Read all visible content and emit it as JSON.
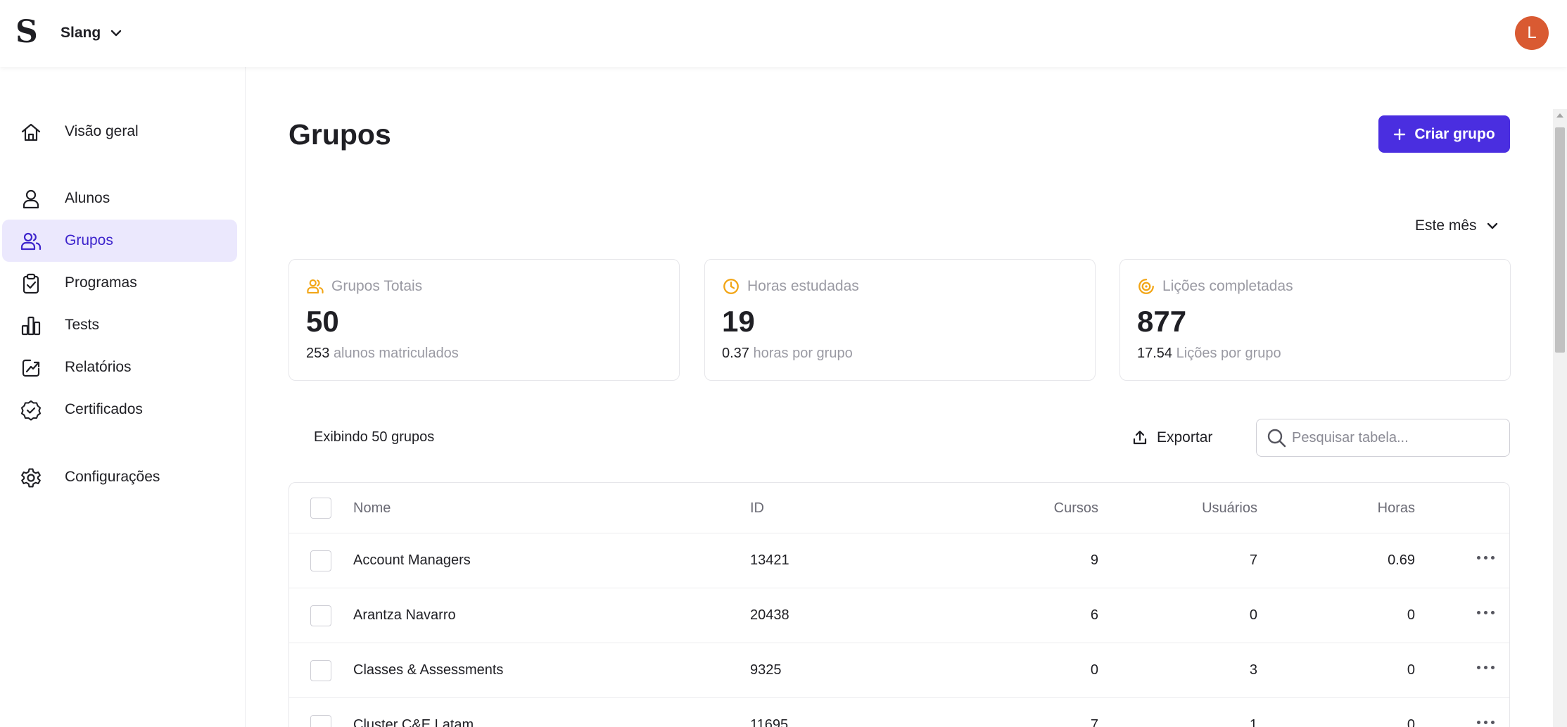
{
  "header": {
    "logo": "S",
    "workspace": "Slang",
    "avatar_initial": "L",
    "avatar_color": "#d95a32"
  },
  "sidebar": {
    "items": [
      {
        "label": "Visão geral",
        "icon": "home-icon",
        "active": false
      },
      {
        "label": "Alunos",
        "icon": "user-icon",
        "active": false
      },
      {
        "label": "Grupos",
        "icon": "users-icon",
        "active": true
      },
      {
        "label": "Programas",
        "icon": "clipboard-check-icon",
        "active": false
      },
      {
        "label": "Tests",
        "icon": "bar-chart-icon",
        "active": false
      },
      {
        "label": "Relatórios",
        "icon": "trending-up-icon",
        "active": false
      },
      {
        "label": "Certificados",
        "icon": "badge-icon",
        "active": false
      },
      {
        "label": "Configurações",
        "icon": "gear-icon",
        "active": false
      }
    ]
  },
  "main": {
    "title": "Grupos",
    "create_button": "Criar grupo",
    "period": "Este mês",
    "stats": [
      {
        "label": "Grupos Totais",
        "value": "50",
        "sub_value": "253",
        "sub_label": "alunos matriculados",
        "icon": "users-icon"
      },
      {
        "label": "Horas estudadas",
        "value": "19",
        "sub_value": "0.37",
        "sub_label": "horas por grupo",
        "icon": "clock-icon"
      },
      {
        "label": "Lições completadas",
        "value": "877",
        "sub_value": "17.54",
        "sub_label": "Lições por grupo",
        "icon": "target-icon"
      }
    ],
    "showing": "Exibindo 50 grupos",
    "export": "Exportar",
    "search_placeholder": "Pesquisar tabela...",
    "accent": "#4a2ee0",
    "stat_icon_color": "#f2a515"
  },
  "table": {
    "columns": {
      "name": "Nome",
      "id": "ID",
      "courses": "Cursos",
      "users": "Usuários",
      "hours": "Horas"
    },
    "rows": [
      {
        "name": "Account Managers",
        "id": "13421",
        "courses": "9",
        "users": "7",
        "hours": "0.69"
      },
      {
        "name": "Arantza Navarro",
        "id": "20438",
        "courses": "6",
        "users": "0",
        "hours": "0"
      },
      {
        "name": "Classes & Assessments",
        "id": "9325",
        "courses": "0",
        "users": "3",
        "hours": "0"
      },
      {
        "name": "Cluster C&E Latam",
        "id": "11695",
        "courses": "7",
        "users": "1",
        "hours": "0"
      }
    ]
  }
}
